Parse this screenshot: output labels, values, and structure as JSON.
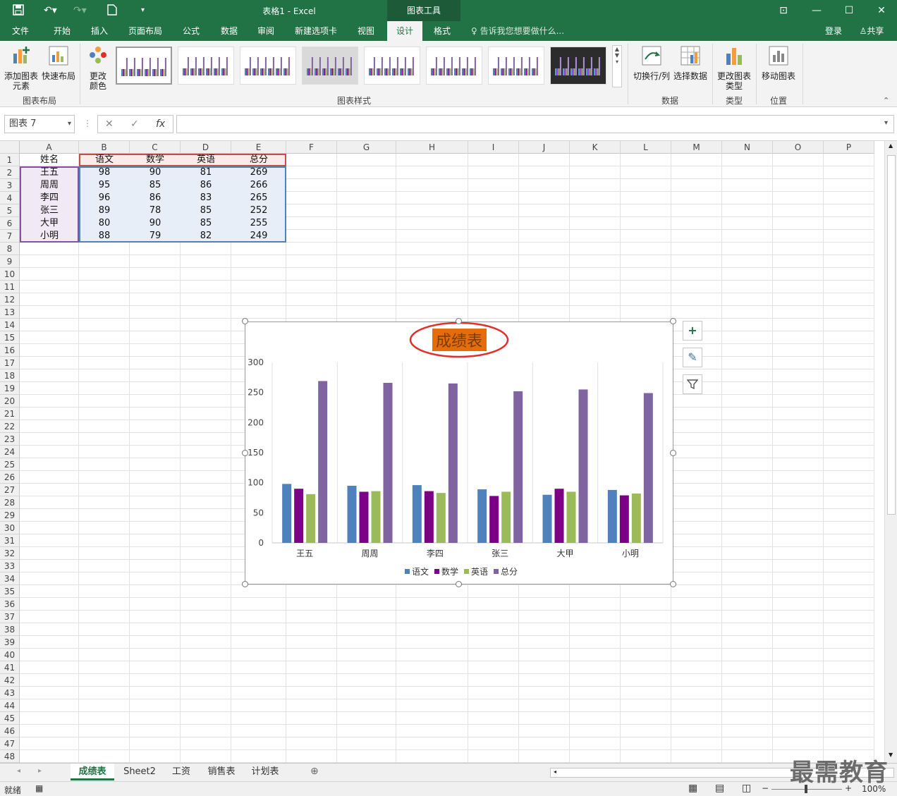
{
  "titlebar": {
    "title": "表格1 - Excel",
    "context_tab": "图表工具",
    "login": "登录",
    "share": "共享"
  },
  "tabs": [
    "文件",
    "开始",
    "插入",
    "页面布局",
    "公式",
    "数据",
    "审阅",
    "新建选项卡",
    "视图",
    "设计",
    "格式"
  ],
  "active_tab": "设计",
  "tell_me": "告诉我您想要做什么...",
  "ribbon": {
    "add_element": "添加图表元素",
    "quick_layout": "快速布局",
    "change_colors": "更改颜色",
    "group_layout": "图表布局",
    "group_styles": "图表样式",
    "switch_rowcol": "切换行/列",
    "select_data": "选择数据",
    "group_data": "数据",
    "change_type": "更改图表类型",
    "group_type": "类型",
    "move_chart": "移动图表",
    "group_location": "位置"
  },
  "formula_bar": {
    "name_box": "图表 7",
    "formula": ""
  },
  "columns": [
    "A",
    "B",
    "C",
    "D",
    "E",
    "F",
    "G",
    "H",
    "I",
    "J",
    "K",
    "L",
    "M",
    "N",
    "O",
    "P"
  ],
  "rows": [
    "1",
    "2",
    "3",
    "4",
    "5",
    "6",
    "7",
    "8",
    "9",
    "10",
    "11",
    "12",
    "13",
    "14",
    "15",
    "16",
    "17",
    "18",
    "19",
    "20",
    "21",
    "22",
    "23",
    "24",
    "25",
    "26",
    "27",
    "28",
    "29",
    "30",
    "31",
    "32",
    "33",
    "34",
    "35",
    "36",
    "37",
    "38",
    "39",
    "40",
    "41",
    "42",
    "43",
    "44",
    "45",
    "46",
    "47",
    "48"
  ],
  "table": {
    "headers": [
      "姓名",
      "语文",
      "数学",
      "英语",
      "总分"
    ],
    "rows": [
      [
        "王五",
        "98",
        "90",
        "81",
        "269"
      ],
      [
        "周周",
        "95",
        "85",
        "86",
        "266"
      ],
      [
        "李四",
        "96",
        "86",
        "83",
        "265"
      ],
      [
        "张三",
        "89",
        "78",
        "85",
        "252"
      ],
      [
        "大甲",
        "80",
        "90",
        "85",
        "255"
      ],
      [
        "小明",
        "88",
        "79",
        "82",
        "249"
      ]
    ]
  },
  "chart_data": {
    "type": "bar",
    "title": "成绩表",
    "categories": [
      "王五",
      "周周",
      "李四",
      "张三",
      "大甲",
      "小明"
    ],
    "series": [
      {
        "name": "语文",
        "color": "#4f81bd",
        "values": [
          98,
          95,
          96,
          89,
          80,
          88
        ]
      },
      {
        "name": "数学",
        "color": "#7b0085",
        "values": [
          90,
          85,
          86,
          78,
          90,
          79
        ]
      },
      {
        "name": "英语",
        "color": "#9bbb59",
        "values": [
          81,
          86,
          83,
          85,
          85,
          82
        ]
      },
      {
        "name": "总分",
        "color": "#8064a2",
        "values": [
          269,
          266,
          265,
          252,
          255,
          249
        ]
      }
    ],
    "ylim": [
      0,
      300
    ],
    "yticks": [
      "0",
      "50",
      "100",
      "150",
      "200",
      "250",
      "300"
    ],
    "legend": "bottom"
  },
  "sheets": [
    "成绩表",
    "Sheet2",
    "工资",
    "销售表",
    "计划表"
  ],
  "active_sheet": "成绩表",
  "status": {
    "ready": "就绪",
    "zoom": "100%"
  },
  "watermark": "最需教育",
  "colors": {
    "accent": "#217346",
    "title_highlight": "#e46c0a",
    "annotation": "#e0302a"
  }
}
